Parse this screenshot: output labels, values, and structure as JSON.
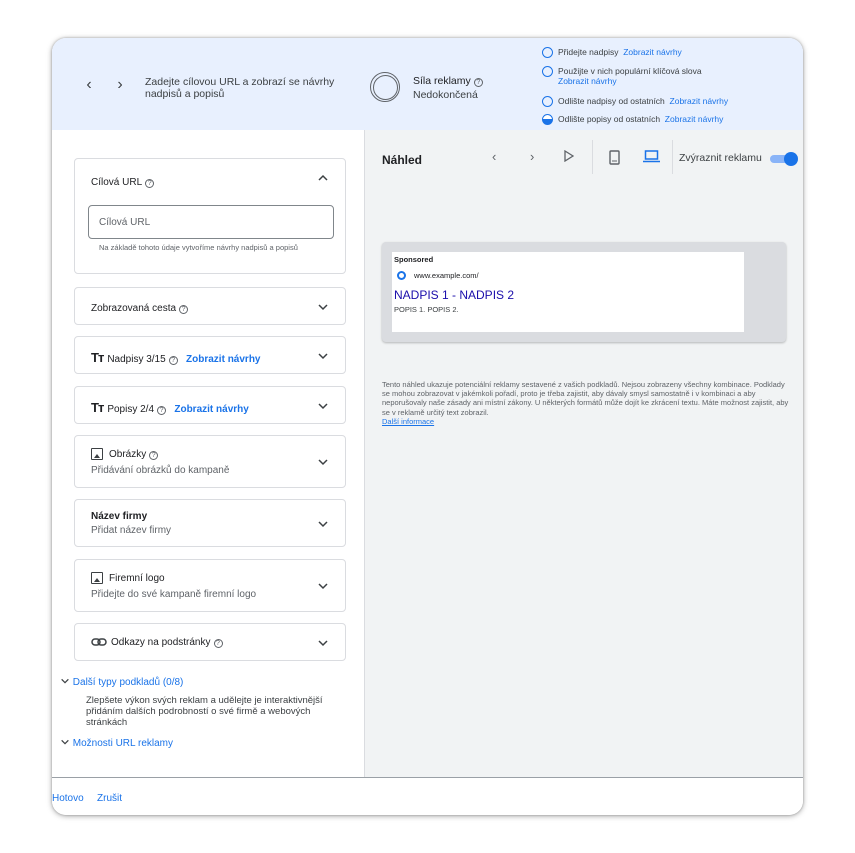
{
  "header": {
    "prev_icon": "chevron-left-icon",
    "next_icon": "chevron-right-icon",
    "title": "Zadejte cílovou URL a zobrazí se návrhy nadpisů a popisů",
    "strength_label": "Síla reklamy",
    "strength_status": "Nedokončená",
    "suggestions": [
      {
        "text": "Přidejte nadpisy",
        "link": "Zobrazit návrhy"
      },
      {
        "text": "Použijte v nich populární klíčová slova",
        "link": "Zobrazit návrhy"
      },
      {
        "text": "Odlište nadpisy od ostatních",
        "link": "Zobrazit návrhy"
      },
      {
        "text": "Odlište popisy od ostatních",
        "link": "Zobrazit návrhy"
      }
    ]
  },
  "left": {
    "final_url": {
      "title": "Cílová URL",
      "placeholder": "Cílová URL",
      "hint": "Na základě tohoto údaje vytvoříme návrhy nadpisů a popisů"
    },
    "display_path": {
      "title": "Zobrazovaná cesta"
    },
    "headlines": {
      "title": "Nadpisy 3/15",
      "link": "Zobrazit návrhy",
      "icon": "text-size-icon"
    },
    "descriptions": {
      "title": "Popisy 2/4",
      "link": "Zobrazit návrhy",
      "icon": "text-size-icon"
    },
    "images": {
      "title": "Obrázky",
      "sub": "Přidávání obrázků do kampaně",
      "icon": "image-icon"
    },
    "business_name": {
      "title": "Název firmy",
      "sub": "Přidat název firmy"
    },
    "logo": {
      "title": "Firemní logo",
      "sub": "Přidejte do své kampaně firemní logo",
      "icon": "image-icon"
    },
    "sitelinks": {
      "title": "Odkazy na podstránky",
      "icon": "link-icon"
    },
    "more_assets": {
      "label": "Další typy podkladů (0/8)",
      "text": "Zlepšete výkon svých reklam a udělejte je interaktivnější přidáním dalších podrobností o své firmě a webových stránkách"
    },
    "url_options": {
      "label": "Možnosti URL reklamy"
    }
  },
  "preview": {
    "title": "Náhled",
    "highlight_label": "Zvýraznit reklamu",
    "highlight_on": true,
    "ad": {
      "sponsored": "Sponsored",
      "url": "www.example.com/",
      "headline": "NADPIS 1 - NADPIS 2",
      "description": "POPIS 1. POPIS 2."
    },
    "note": "Tento náhled ukazuje potenciální reklamy sestavené z vašich podkladů. Nejsou zobrazeny všechny kombinace. Podklady se mohou zobrazovat v jakémkoli pořadí, proto je třeba zajistit, aby dávaly smysl samostatně i v kombinaci a aby neporušovaly naše zásady ani místní zákony. U některých formátů může dojít ke zkrácení textu. Máte možnost zajistit, aby se v reklamě určitý text zobrazil.",
    "note_link": "Další informace"
  },
  "footer": {
    "done": "Hotovo",
    "cancel": "Zrušit"
  },
  "colors": {
    "accent": "#1a73e8",
    "header_bg": "#e8f0fe",
    "preview_bg": "#f1f3f4",
    "ad_headline": "#1a0dab"
  }
}
